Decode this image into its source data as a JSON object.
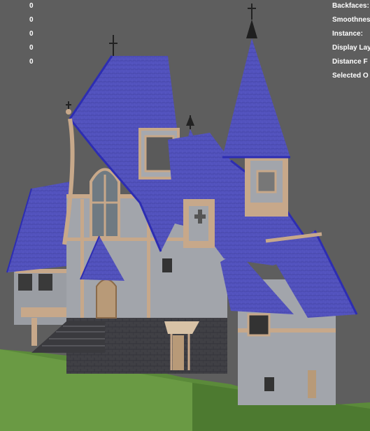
{
  "viewport": {
    "stats_left": [
      "0",
      "0",
      "0",
      "0",
      "0"
    ],
    "stats_right": [
      "Backfaces:",
      "Smoothness",
      "Instance:",
      "Display Lay",
      "Distance F",
      "Selected O"
    ]
  },
  "colors": {
    "background": "#5e5e5e",
    "roof": "#4f4fb9",
    "roof_edge": "#2d2db2",
    "wood": "#c7a88a",
    "wall": "#9fa2a8",
    "stone": "#3f3f43",
    "grass": "#5e8a3c"
  },
  "icons": {
    "finial": "cross-finial-icon"
  }
}
